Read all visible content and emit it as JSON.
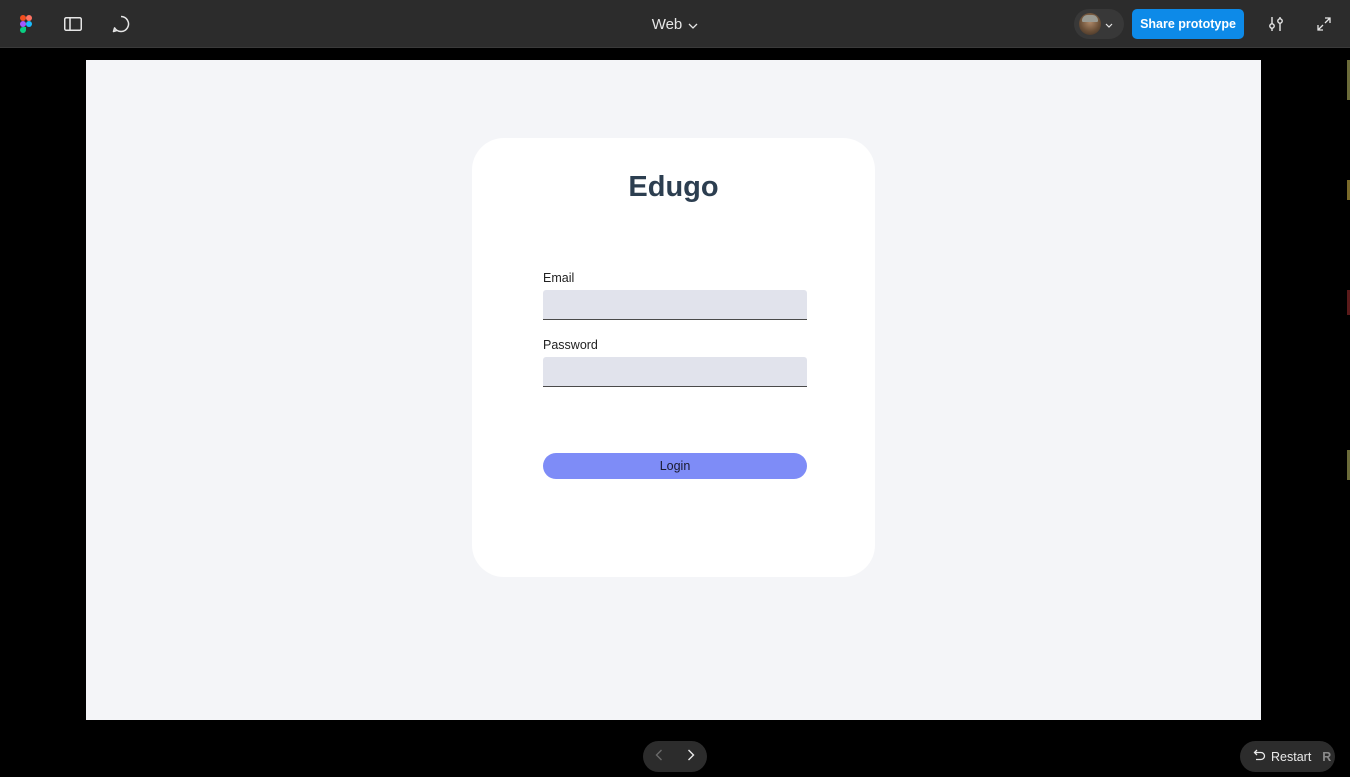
{
  "toolbar": {
    "title": "Web",
    "share_label": "Share prototype"
  },
  "login_form": {
    "brand": "Edugo",
    "email_label": "Email",
    "email_value": "",
    "password_label": "Password",
    "password_value": "",
    "login_label": "Login"
  },
  "footer": {
    "restart_label": "Restart",
    "restart_shortcut": "R"
  },
  "icons": [
    "figma-logo",
    "sidebar-panel-icon",
    "comment-icon",
    "chevron-down-icon",
    "settings-sliders-icon",
    "expand-icon",
    "arrow-left-icon",
    "arrow-right-icon",
    "restart-icon"
  ],
  "colors": {
    "accent": "#0d8ae8",
    "login_button": "#7e8cf7",
    "brand_text": "#2c3e50",
    "canvas_bg": "#f4f5f8"
  }
}
